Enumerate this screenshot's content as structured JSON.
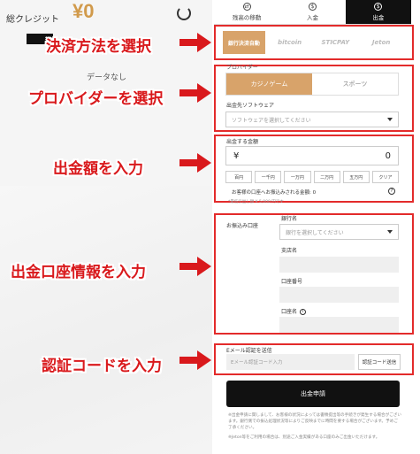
{
  "header": {
    "credit_label": "総クレジット",
    "credit_value": "¥0",
    "no_data": "データなし"
  },
  "tabs": [
    {
      "label": "残高の移動",
      "icon": "transfer-icon"
    },
    {
      "label": "入金",
      "icon": "dollar-icon"
    },
    {
      "label": "出金",
      "icon": "dollar-icon",
      "active": true
    }
  ],
  "payment_methods": [
    "銀行決済自動",
    "bitcoin",
    "STICPAY",
    "Jeton"
  ],
  "provider": {
    "label": "プロバイダー",
    "options": [
      "カジノゲーム",
      "スポーツ"
    ],
    "software_label": "出金先ソフトウェア",
    "software_placeholder": "ソフトウェアを選択してください"
  },
  "amount": {
    "label": "出金する金額",
    "currency": "¥",
    "value": "0",
    "chips": [
      "百円",
      "一千円",
      "一万円",
      "二万円",
      "五万円",
      "クリア"
    ],
    "receive_note": "お客様の口座へお振込みされる金額:",
    "receive_value": "0",
    "min_note": "*最低引出し額 ¥ 5,000 円です"
  },
  "bank": {
    "section_label": "お振込み口座",
    "bank_name_label": "銀行名",
    "bank_placeholder": "銀行を選択してください",
    "branch_label": "支店名",
    "account_number_label": "口座番号",
    "account_name_label": "口座名"
  },
  "verification": {
    "label": "Eメール認証を送信",
    "input_placeholder": "Eメール認証コード入力",
    "button_label": "認証コード送信"
  },
  "submit_label": "出金申請",
  "notes": [
    "※出金申請に関しまして、お客様の状況によっては書類提出等の手続きが発生する場合がございます。銀行側での振込処理状況等によりご反映までに時間を要する場合がございます。予めご了承ください。",
    "※Jeton等をご利用の場合は、別途ご入金実績がある口座のみご出金いただけます。"
  ],
  "callouts": [
    "決済方法を選択",
    "プロバイダーを選択",
    "出金額を入力",
    "出金口座情報を入力",
    "認証コードを入力"
  ],
  "colors": {
    "accent": "#d8a36a",
    "highlight": "#e32b2b",
    "callout": "#d9191c",
    "credit": "#d19a4b"
  }
}
